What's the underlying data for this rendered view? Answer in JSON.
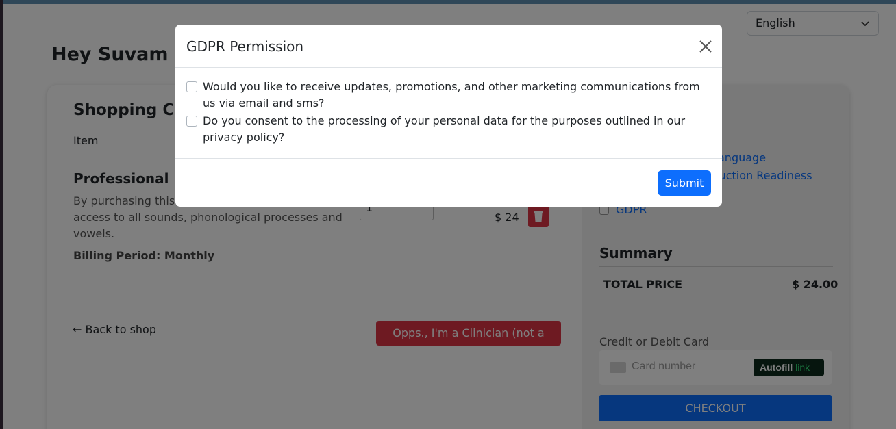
{
  "language_select": {
    "value": "English"
  },
  "greeting": "Hey Suvam M,",
  "cart": {
    "title": "Shopping Cart",
    "column_item": "Item",
    "product_name": "Professional",
    "product_description": "By purchasing this product you will have full access to all sounds, phonological processes and vowels.",
    "billing_period": "Billing Period: Monthly",
    "quantity": "1",
    "price": "$ 24",
    "back_link": "← Back to shop",
    "clinician_button": "Opps., I'm a Clinician (not a Parent)"
  },
  "options": {
    "link1": "anguage",
    "link2": "ruction Readiness",
    "gdpr_label": "GDPR"
  },
  "summary": {
    "title": "Summary",
    "total_label": "TOTAL PRICE",
    "total_value": "$ 24.00",
    "card_label": "Credit or Debit Card",
    "card_placeholder": "Card number",
    "autofill_label": "Autofill",
    "autofill_link": "link",
    "checkout_button": "CHECKOUT"
  },
  "modal": {
    "title": "GDPR Permission",
    "consent_marketing": "Would you like to receive updates, promotions, and other marketing communications from us via email and sms?",
    "consent_processing": "Do you consent to the processing of your personal data for the purposes outlined in our privacy policy?",
    "submit_button": "Submit"
  },
  "colors": {
    "primary": "#0d6efd",
    "danger": "#dc3545"
  }
}
